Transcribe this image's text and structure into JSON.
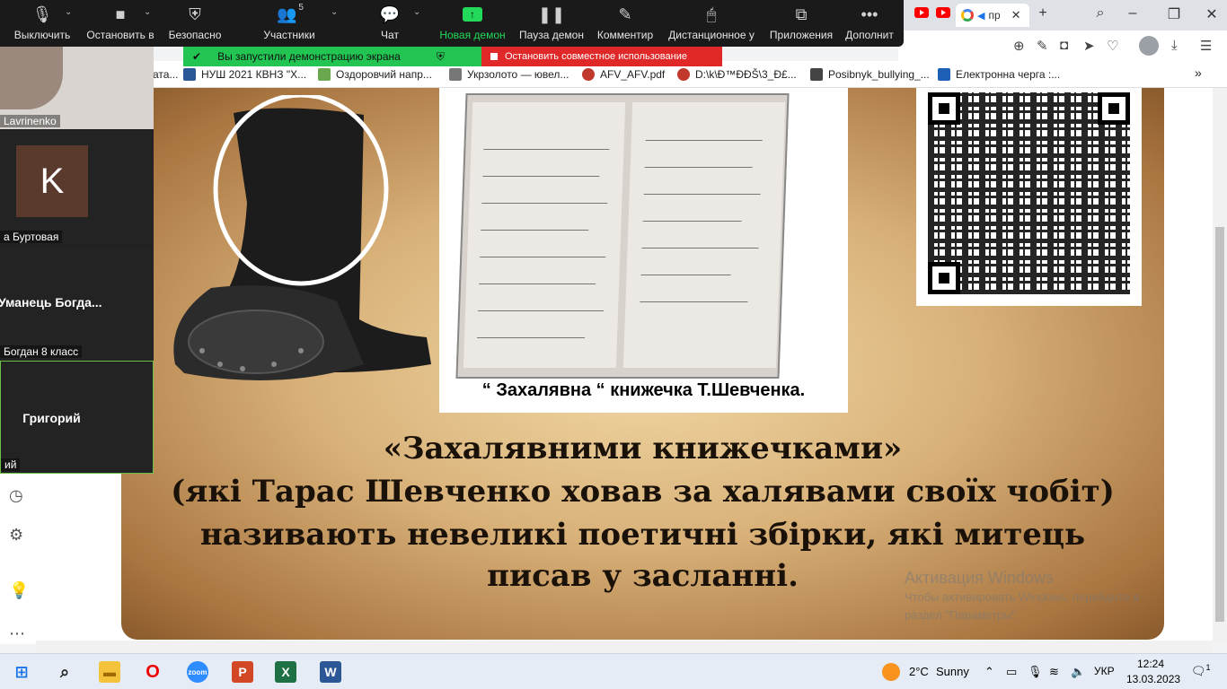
{
  "browser": {
    "tab_title": "пр",
    "bookmarks": [
      {
        "label": "ата..."
      },
      {
        "label": "НУШ 2021 КВНЗ \"Х..."
      },
      {
        "label": "Оздоровчий напр..."
      },
      {
        "label": "Укрзолото — ювел..."
      },
      {
        "label": "AFV_AFV.pdf"
      },
      {
        "label": "D:\\k\\Ð™ÐÐŠ\\3_Ð£..."
      },
      {
        "label": "Posibnyk_bullying_..."
      },
      {
        "label": "Електронна черга :..."
      }
    ],
    "more_bookmarks": "»"
  },
  "zoom_toolbar": {
    "items": [
      {
        "icon": "microphone-icon",
        "label": "Выключить"
      },
      {
        "icon": "camera-icon",
        "label": "Остановить в"
      },
      {
        "icon": "shield-icon",
        "label": "Безопасно"
      },
      {
        "icon": "participants-icon",
        "label": "Участники",
        "count": "5"
      },
      {
        "icon": "chat-icon",
        "label": "Чат"
      },
      {
        "icon": "share-screen-icon",
        "label": "Новая демон"
      },
      {
        "icon": "pause-icon",
        "label": "Пауза демон"
      },
      {
        "icon": "pen-icon",
        "label": "Комментир"
      },
      {
        "icon": "remote-control-icon",
        "label": "Дистанционное у"
      },
      {
        "icon": "apps-icon",
        "label": "Приложения"
      },
      {
        "icon": "more-icon",
        "label": "Дополнит"
      }
    ],
    "share_banner": "Вы запустили демонстрацию экрана",
    "stop_banner": "Остановить совместное использование"
  },
  "participants": [
    {
      "name": "Lavrinenko"
    },
    {
      "avatar_letter": "K",
      "name": "а Буртовая"
    },
    {
      "display": "Уманець  Богда...",
      "name": "Богдан 8 класс"
    },
    {
      "display": "Григорий",
      "name": "ий"
    }
  ],
  "slide": {
    "book_caption": "“ Захалявна “ книжечка Т.Шевченка.",
    "line1": "«Захалявними книжечками»",
    "line2": "(які Тарас Шевченко ховав за халявами своїх чобіт)",
    "line3": "називають невеликі поетичні збірки, які митець",
    "line4": "писав у засланні."
  },
  "watermark": {
    "title": "Активация Windows",
    "line1": "Чтобы активировать Windows, перейдите в",
    "line2": "раздел \"Параметры\"."
  },
  "taskbar": {
    "weather_temp": "2°C",
    "weather_text": "Sunny",
    "language": "УКР",
    "time": "12:24",
    "date": "13.03.2023",
    "notifications": "1"
  }
}
